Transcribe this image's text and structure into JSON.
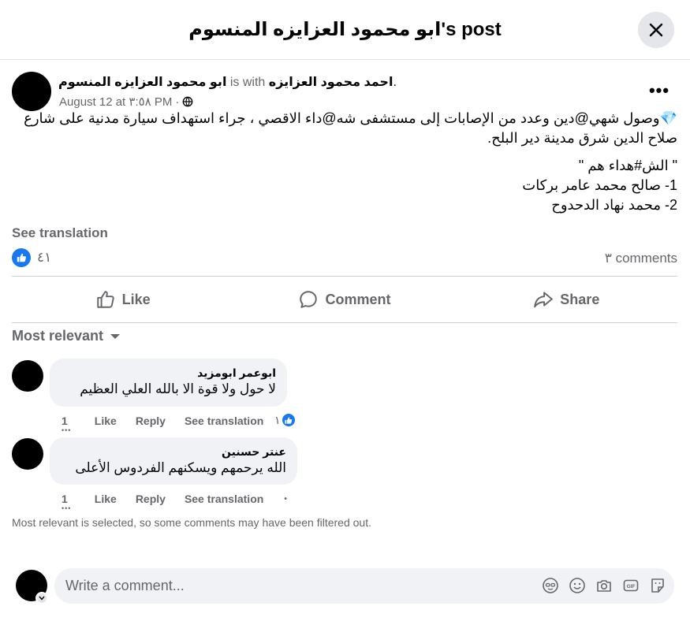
{
  "header": {
    "title": "ابو محمود العزايزه المنسوم's post",
    "close_icon": "close-icon"
  },
  "post": {
    "author": "ابو محمود العزايزه المنسوم",
    "with_text": "is with",
    "tagged": "احمد محمود العزايزه",
    "tagged_suffix": ".",
    "date": "August 12 at ٣:٥٨ PM",
    "separator": "·",
    "privacy_icon": "globe-icon",
    "more_label": "•••",
    "body_line1": "💎وصول شهي@دين وعدد من الإصابات إلى مستشفى شه@داء الاقصي ، جراء استهداف سيارة مدنية على شارع صلاح الدين شرق مدينة دير البلح.",
    "martyrs_title": "\" الش#هداء هم \"",
    "martyr_1": "1- صالح محمد عامر بركات",
    "martyr_2": "2- محمد نهاد الدحدوح",
    "see_translation": "See translation",
    "reaction_count": "٤١",
    "comments_count": "٣ comments"
  },
  "actions": {
    "like": "Like",
    "comment": "Comment",
    "share": "Share"
  },
  "sort": {
    "label": "Most relevant"
  },
  "comments": [
    {
      "author": "ابوعمر ابومزيد",
      "text": "لا حول ولا قوة الا بالله العلي العظيم",
      "time": "1",
      "like": "Like",
      "reply": "Reply",
      "see_translation": "See translation",
      "reaction_count": "١"
    },
    {
      "author": "عنتر حسنين",
      "text": "الله يرحمهم ويسكنهم الفردوس الأعلى",
      "time": "1",
      "like": "Like",
      "reply": "Reply",
      "see_translation": "See translation",
      "bullet": "•"
    }
  ],
  "filter_note": "Most relevant is selected, so some comments may have been filtered out.",
  "composer": {
    "placeholder": "Write a comment...",
    "icons": [
      "avatar-sticker-icon",
      "emoji-icon",
      "camera-icon",
      "gif-icon",
      "sticker-icon"
    ]
  },
  "colors": {
    "accent": "#1877f2",
    "muted": "#65676b",
    "bubble": "#f0f2f5"
  }
}
